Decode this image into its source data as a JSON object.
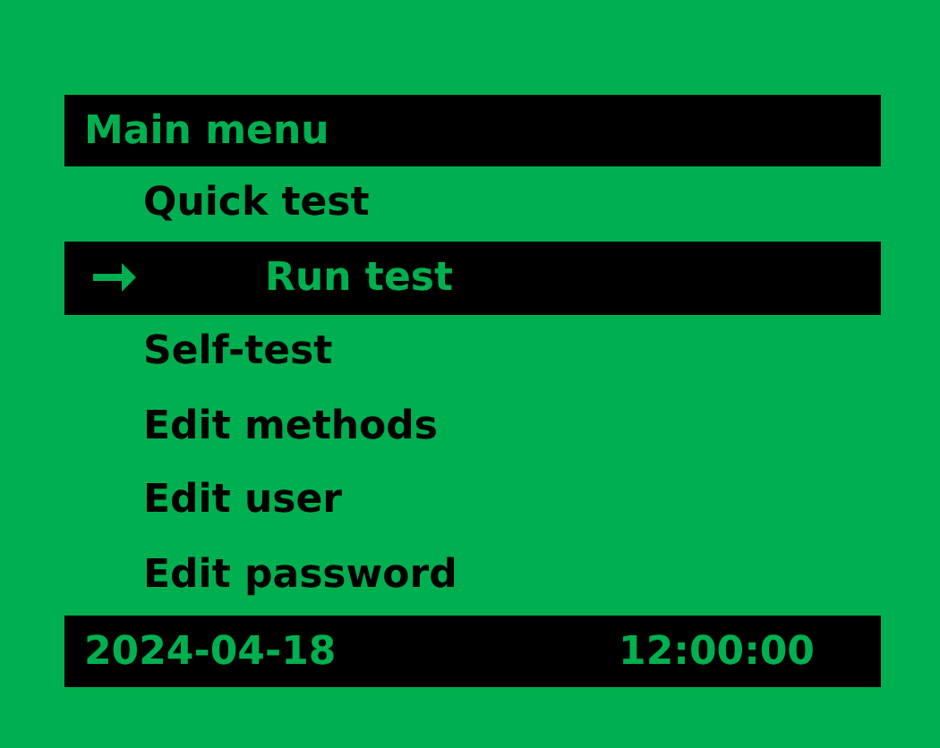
{
  "title": "Main menu",
  "items": [
    {
      "label": "Quick test",
      "selected": false
    },
    {
      "label": "Run test",
      "selected": true
    },
    {
      "label": "Self-test",
      "selected": false
    },
    {
      "label": "Edit methods",
      "selected": false
    },
    {
      "label": "Edit user",
      "selected": false
    },
    {
      "label": "Edit password",
      "selected": false
    }
  ],
  "status_bar": {
    "date": "2024-04-18",
    "time": "12:00:00"
  }
}
